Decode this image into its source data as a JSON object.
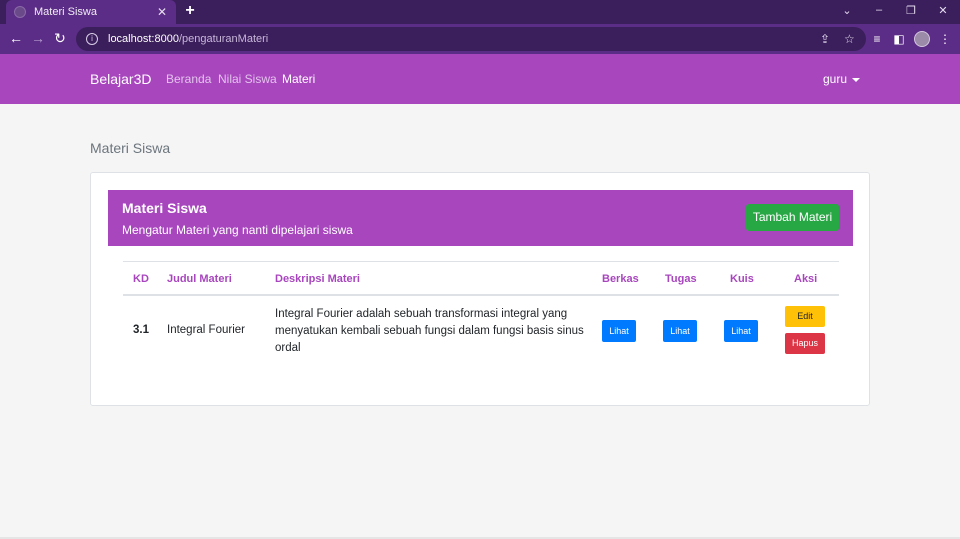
{
  "browser": {
    "tab_title": "Materi Siswa",
    "tab_close": "✕",
    "new_tab": "+",
    "url_host": "localhost:8000",
    "url_path": "/pengaturanMateri"
  },
  "navbar": {
    "brand": "Belajar3D",
    "links": [
      "Beranda",
      "Nilai Siswa",
      "Materi"
    ],
    "active_link": "Materi",
    "user": "guru"
  },
  "page": {
    "title": "Materi Siswa"
  },
  "banner": {
    "title": "Materi Siswa",
    "subtitle": "Mengatur Materi yang nanti dipelajari siswa",
    "add_button": "Tambah Materi"
  },
  "table": {
    "headers": [
      "KD",
      "Judul Materi",
      "Deskripsi Materi",
      "Berkas",
      "Tugas",
      "Kuis",
      "Aksi"
    ],
    "rows": [
      {
        "kd": "3.1",
        "judul": "Integral Fourier",
        "deskripsi_lines": [
          "Integral Fourier adalah sebuah transformasi integral yang",
          "menyatukan kembali sebuah fungsi dalam fungsi basis sinus",
          "ordal"
        ],
        "berkas": "Lihat",
        "tugas": "Lihat",
        "kuis": "Lihat",
        "edit": "Edit",
        "hapus": "Hapus"
      }
    ]
  },
  "colors": {
    "primary_purple": "#a846be",
    "success_green": "#28a745",
    "info_blue": "#007bff",
    "warning_yellow": "#ffc107",
    "danger_red": "#dc3545"
  }
}
